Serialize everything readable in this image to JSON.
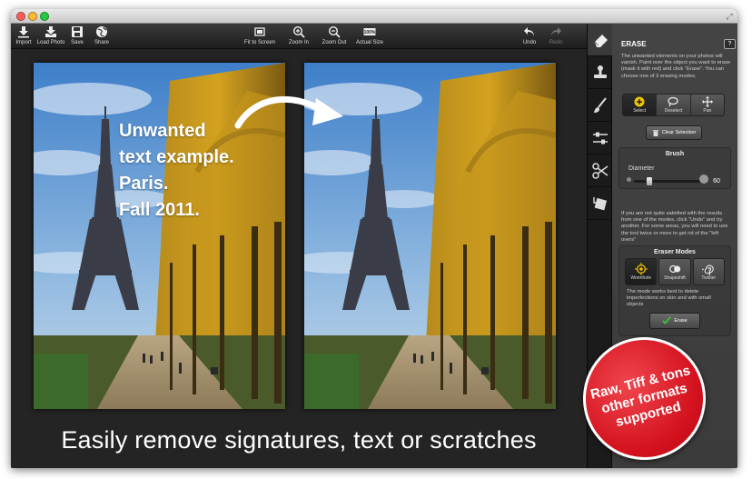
{
  "toolbar": {
    "import": "Import",
    "load_photo": "Load Photo",
    "save": "Save",
    "share": "Share",
    "fit_to_screen": "Fit to Screen",
    "zoom_in": "Zoom In",
    "zoom_out": "Zoom Out",
    "actual_size": "Actual Size",
    "actual_size_glyph": "100%",
    "undo": "Undo",
    "redo": "Redo"
  },
  "overlay_text": [
    "Unwanted",
    "text example.",
    "Paris.",
    "Fall 2011."
  ],
  "caption": "Easily remove signatures, text or scratches",
  "panel": {
    "title": "ERASE",
    "help": "?",
    "intro": "The unwanted elements on your photos will vanish. Paint over the object you want to erase (mask it with red) and click \"Erase\". You can choose one of 3 erasing modes.",
    "modes": [
      {
        "label": "Select",
        "icon": "plus-icon",
        "selected": true
      },
      {
        "label": "Deselect",
        "icon": "lasso-icon",
        "selected": false
      },
      {
        "label": "Pan",
        "icon": "move-icon",
        "selected": false
      }
    ],
    "clear_selection": "Clear Selection",
    "brush_title": "Brush",
    "diameter_label": "Diameter",
    "diameter_value": "60",
    "diameter_fraction": 0.22,
    "tip": "If you are not quite satisfied with the results from one of the modes, click \"Undo\" and try another. For some areas, you will need to use the tool twice or more to get rid of the \"left overs\"",
    "eraser_modes_title": "Eraser Modes",
    "eraser_modes": [
      {
        "label": "Wormhole",
        "selected": true
      },
      {
        "label": "Shapeshift",
        "selected": false
      },
      {
        "label": "Twister",
        "selected": false
      }
    ],
    "mode_desc": "The mode works best to delete imperfections on skin and with small objects",
    "erase_button": "Erase"
  },
  "badge": [
    "Raw, Tiff & tons",
    "other formats",
    "supported"
  ],
  "colors": {
    "accent_yellow": "#f2c400",
    "badge_red": "#d3121e",
    "checkmark_green": "#3fc13a"
  }
}
